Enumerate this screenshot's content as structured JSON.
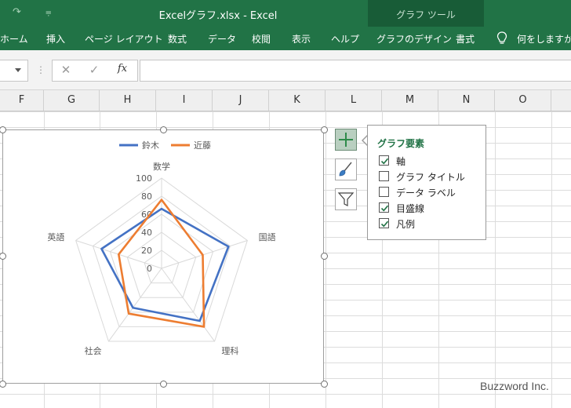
{
  "title_bar": {
    "document_title": "Excelグラフ.xlsx  -  Excel",
    "context_group": "グラフ ツール",
    "qat": {
      "redo_glyph": "↷",
      "customize_glyph": "⩦"
    }
  },
  "ribbon": {
    "tabs": [
      "ホーム",
      "挿入",
      "ページ レイアウト",
      "数式",
      "データ",
      "校閲",
      "表示",
      "ヘルプ",
      "グラフのデザイン",
      "書式"
    ],
    "tell_me": "何をしますか"
  },
  "formula_bar": {
    "cancel": "✕",
    "enter": "✓",
    "fx": "fx",
    "value": ""
  },
  "columns": [
    "F",
    "G",
    "H",
    "I",
    "J",
    "K",
    "L",
    "M",
    "N",
    "O"
  ],
  "chart_data": {
    "type": "radar",
    "categories": [
      "数学",
      "国語",
      "理科",
      "社会",
      "英語"
    ],
    "series": [
      {
        "name": "鈴木",
        "color": "#4472c4",
        "values": [
          66,
          78,
          72,
          54,
          70
        ]
      },
      {
        "name": "近藤",
        "color": "#ed7d31",
        "values": [
          76,
          48,
          80,
          62,
          50
        ]
      }
    ],
    "r_ticks": [
      "0",
      "20",
      "40",
      "60",
      "80",
      "100"
    ],
    "rlim": [
      0,
      100
    ],
    "legend_position": "top"
  },
  "chart_elements_panel": {
    "title": "グラフ要素",
    "options": [
      {
        "label": "軸",
        "checked": true
      },
      {
        "label": "グラフ タイトル",
        "checked": false
      },
      {
        "label": "データ ラベル",
        "checked": false
      },
      {
        "label": "目盛線",
        "checked": true
      },
      {
        "label": "凡例",
        "checked": true
      }
    ]
  },
  "watermark": "Buzzword Inc."
}
